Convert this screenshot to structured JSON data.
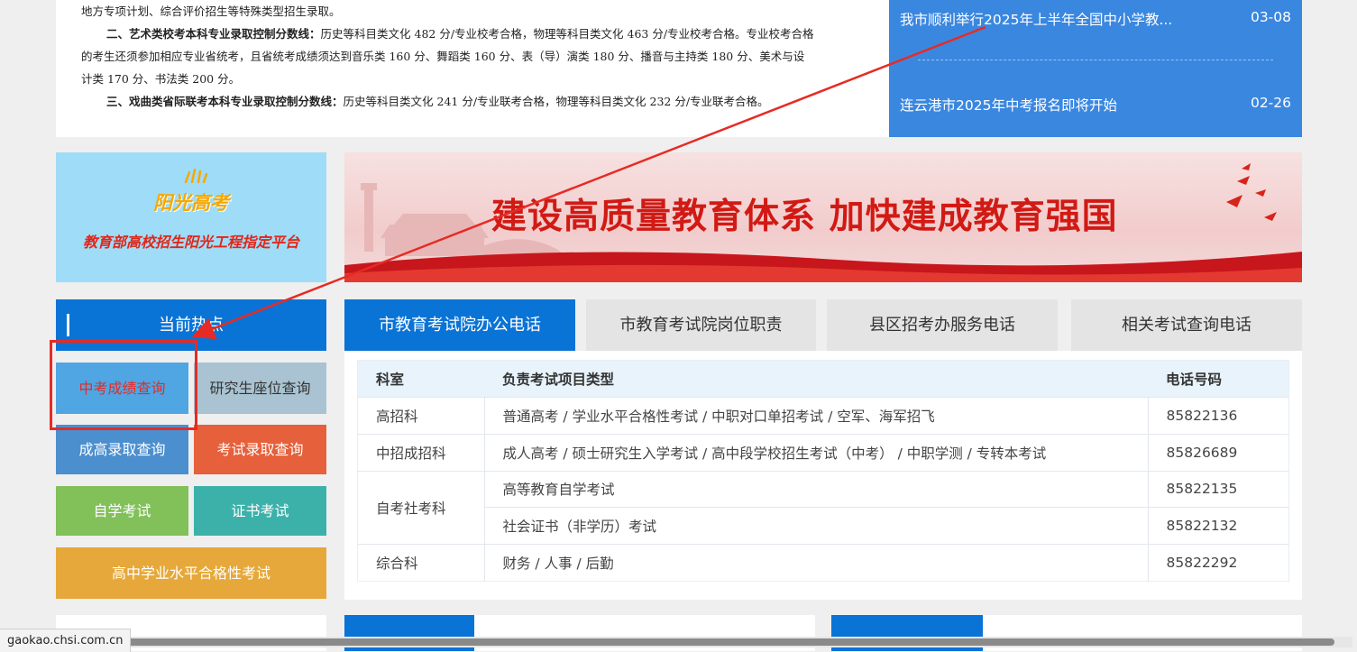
{
  "article": {
    "line1": "地方专项计划、综合评价招生等特殊类型招生录取。",
    "line2_bold": "二、艺术类校考本科专业录取控制分数线：",
    "line2_rest": "历史等科目类文化 482 分/专业校考合格，物理等科目类文化 463 分/专业校考合格。专业校考合格",
    "line3": "的考生还须参加相应专业省统考，且省统考成绩须达到音乐类 160 分、舞蹈类 160 分、表（导）演类 180 分、播音与主持类 180 分、美术与设",
    "line4": "计类 170 分、书法类 200 分。",
    "line5_bold": "三、戏曲类省际联考本科专业录取控制分数线：",
    "line5_rest": "历史等科目类文化 241 分/专业联考合格，物理等科目类文化 232 分/专业联考合格。"
  },
  "news": [
    {
      "title": "我市顺利举行2025年上半年全国中小学教...",
      "date": "03-08"
    },
    {
      "title": "连云港市2025年中考报名即将开始",
      "date": "02-26"
    }
  ],
  "logo": {
    "brand": "阳光高考",
    "tagline": "教育部高校招生阳光工程指定平台"
  },
  "banner": {
    "slogan": "建设高质量教育体系 加快建成教育强国"
  },
  "hot": {
    "title": "当前热点",
    "buttons": [
      {
        "label": "中考成绩查询",
        "bg": "#4fa6e3",
        "color": "#e62b24"
      },
      {
        "label": "研究生座位查询",
        "bg": "#a9c3d2",
        "color": "#333333"
      },
      {
        "label": "成高录取查询",
        "bg": "#4b8fcf"
      },
      {
        "label": "考试录取查询",
        "bg": "#e5603b"
      },
      {
        "label": "自学考试",
        "bg": "#82c05a"
      },
      {
        "label": "证书考试",
        "bg": "#3cb1aa"
      },
      {
        "label": "高中学业水平合格性考试",
        "bg": "#e6a83a"
      }
    ]
  },
  "tabs": [
    {
      "label": "市教育考试院办公电话",
      "active": true
    },
    {
      "label": "市教育考试院岗位职责",
      "active": false
    },
    {
      "label": "县区招考办服务电话",
      "active": false
    },
    {
      "label": "相关考试查询电话",
      "active": false
    }
  ],
  "table": {
    "headers": [
      "科室",
      "负责考试项目类型",
      "电话号码"
    ],
    "rows": [
      {
        "dept": "高招科",
        "items": "普通高考 / 学业水平合格性考试 / 中职对口单招考试 / 空军、海军招飞",
        "phone": "85822136"
      },
      {
        "dept": "中招成招科",
        "items": "成人高考 / 硕士研究生入学考试 / 高中段学校招生考试（中考） / 中职学测 / 专转本考试",
        "phone": "85826689"
      },
      {
        "dept": "自考社考科",
        "items": "高等教育自学考试",
        "phone": "85822135"
      },
      {
        "dept": "",
        "items": "社会证书（非学历）考试",
        "phone": "85822132"
      },
      {
        "dept": "综合科",
        "items": "财务 / 人事 / 后勤",
        "phone": "85822292"
      }
    ]
  },
  "status": {
    "url": "gaokao.chsi.com.cn"
  },
  "colors": {
    "accent": "#0a73d6",
    "news_bg": "#3a87e0",
    "annotation": "#e62b24"
  }
}
